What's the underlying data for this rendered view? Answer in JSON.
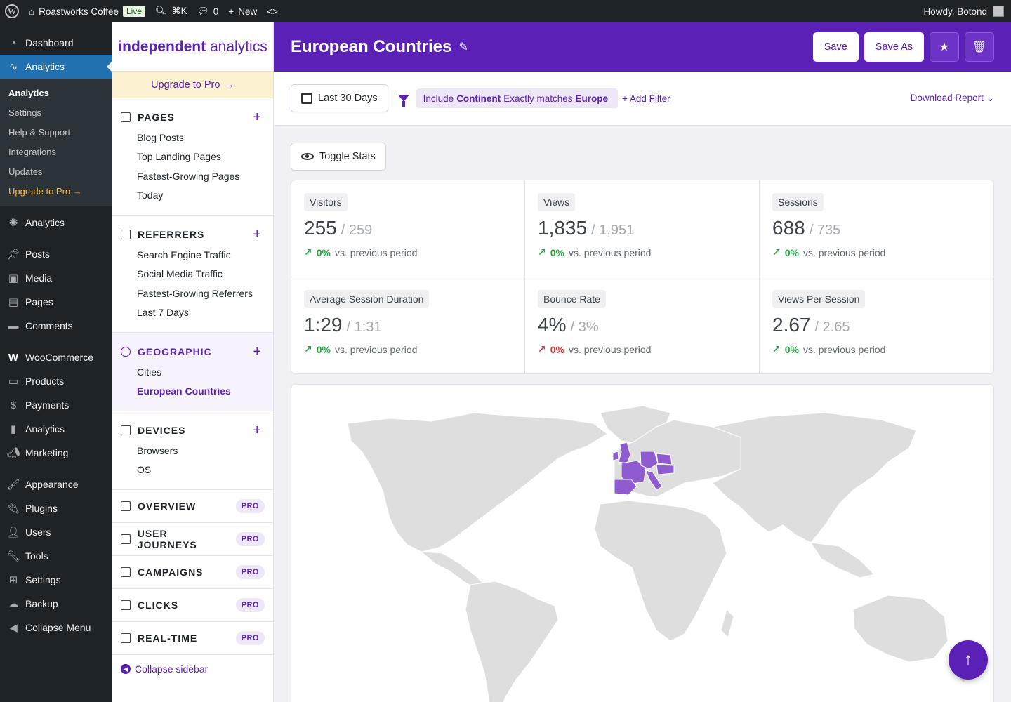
{
  "adminbar": {
    "site_name": "Roastworks Coffee",
    "live_badge": "Live",
    "shortcut": "⌘K",
    "comments_count": "0",
    "new_label": "New",
    "greeting": "Howdy, Botond"
  },
  "wpmenu": {
    "dashboard": "Dashboard",
    "analytics": "Analytics",
    "sub": [
      "Analytics",
      "Settings",
      "Help & Support",
      "Integrations",
      "Updates",
      "Upgrade to Pro →"
    ],
    "analytics2": "Analytics",
    "posts": "Posts",
    "media": "Media",
    "pages": "Pages",
    "comments": "Comments",
    "woocommerce": "WooCommerce",
    "products": "Products",
    "payments": "Payments",
    "analytics3": "Analytics",
    "marketing": "Marketing",
    "appearance": "Appearance",
    "plugins": "Plugins",
    "users": "Users",
    "tools": "Tools",
    "settings": "Settings",
    "backup": "Backup",
    "collapse": "Collapse Menu"
  },
  "sidebar": {
    "brand_bold": "independent",
    "brand_rest": "analytics",
    "upgrade": "Upgrade to Pro",
    "pages": {
      "title": "PAGES",
      "links": [
        "Blog Posts",
        "Top Landing Pages",
        "Fastest-Growing Pages",
        "Today"
      ]
    },
    "referrers": {
      "title": "REFERRERS",
      "links": [
        "Search Engine Traffic",
        "Social Media Traffic",
        "Fastest-Growing Referrers",
        "Last 7 Days"
      ]
    },
    "geographic": {
      "title": "GEOGRAPHIC",
      "links": [
        "Cities",
        "European Countries"
      ]
    },
    "devices": {
      "title": "DEVICES",
      "links": [
        "Browsers",
        "OS"
      ]
    },
    "pro_sections": [
      "OVERVIEW",
      "USER JOURNEYS",
      "CAMPAIGNS",
      "CLICKS",
      "REAL-TIME"
    ],
    "pro_badge": "PRO",
    "collapse": "Collapse sidebar"
  },
  "header": {
    "title": "European Countries",
    "save": "Save",
    "save_as": "Save As"
  },
  "toolbar": {
    "date_range": "Last 30 Days",
    "filter_include": "Include",
    "filter_field": "Continent",
    "filter_op": "Exactly matches",
    "filter_value": "Europe",
    "add_filter": "+ Add Filter",
    "download": "Download Report"
  },
  "toggle_stats": "Toggle Stats",
  "stats": [
    {
      "label": "Visitors",
      "value": "255",
      "prev": "/ 259",
      "pct": "0%",
      "cmp": "vs. previous period",
      "trend": "up-good"
    },
    {
      "label": "Views",
      "value": "1,835",
      "prev": "/ 1,951",
      "pct": "0%",
      "cmp": "vs. previous period",
      "trend": "up-good"
    },
    {
      "label": "Sessions",
      "value": "688",
      "prev": "/ 735",
      "pct": "0%",
      "cmp": "vs. previous period",
      "trend": "up-good"
    },
    {
      "label": "Average Session Duration",
      "value": "1:29",
      "prev": "/ 1:31",
      "pct": "0%",
      "cmp": "vs. previous period",
      "trend": "up-good"
    },
    {
      "label": "Bounce Rate",
      "value": "4%",
      "prev": "/ 3%",
      "pct": "0%",
      "cmp": "vs. previous period",
      "trend": "up-bad"
    },
    {
      "label": "Views Per Session",
      "value": "2.67",
      "prev": "/ 2.65",
      "pct": "0%",
      "cmp": "vs. previous period",
      "trend": "up-good"
    }
  ],
  "colors": {
    "accent": "#5b21b6",
    "map_land": "#dedede",
    "map_highlight": "#8e5cd0",
    "positive": "#28a745",
    "negative": "#d63638"
  }
}
